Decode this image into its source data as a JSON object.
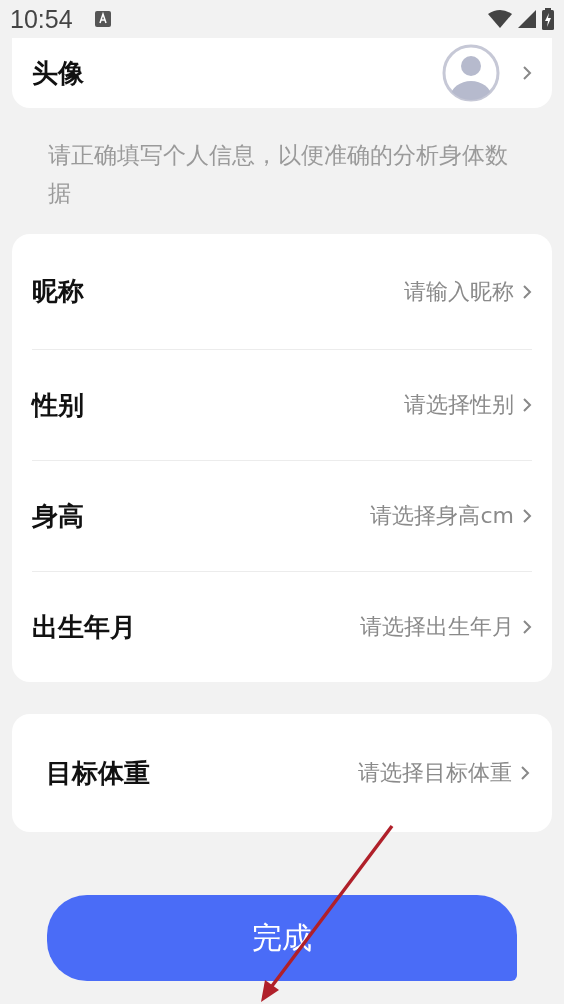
{
  "status_bar": {
    "time": "10:54"
  },
  "avatar_row": {
    "label": "头像"
  },
  "hint": "请正确填写个人信息，以便准确的分析身体数据",
  "profile_rows": [
    {
      "label": "昵称",
      "placeholder": "请输入昵称"
    },
    {
      "label": "性别",
      "placeholder": "请选择性别"
    },
    {
      "label": "身高",
      "placeholder": "请选择身高cm"
    },
    {
      "label": "出生年月",
      "placeholder": "请选择出生年月"
    }
  ],
  "goal_row": {
    "label": "目标体重",
    "placeholder": "请选择目标体重"
  },
  "done_button": "完成"
}
